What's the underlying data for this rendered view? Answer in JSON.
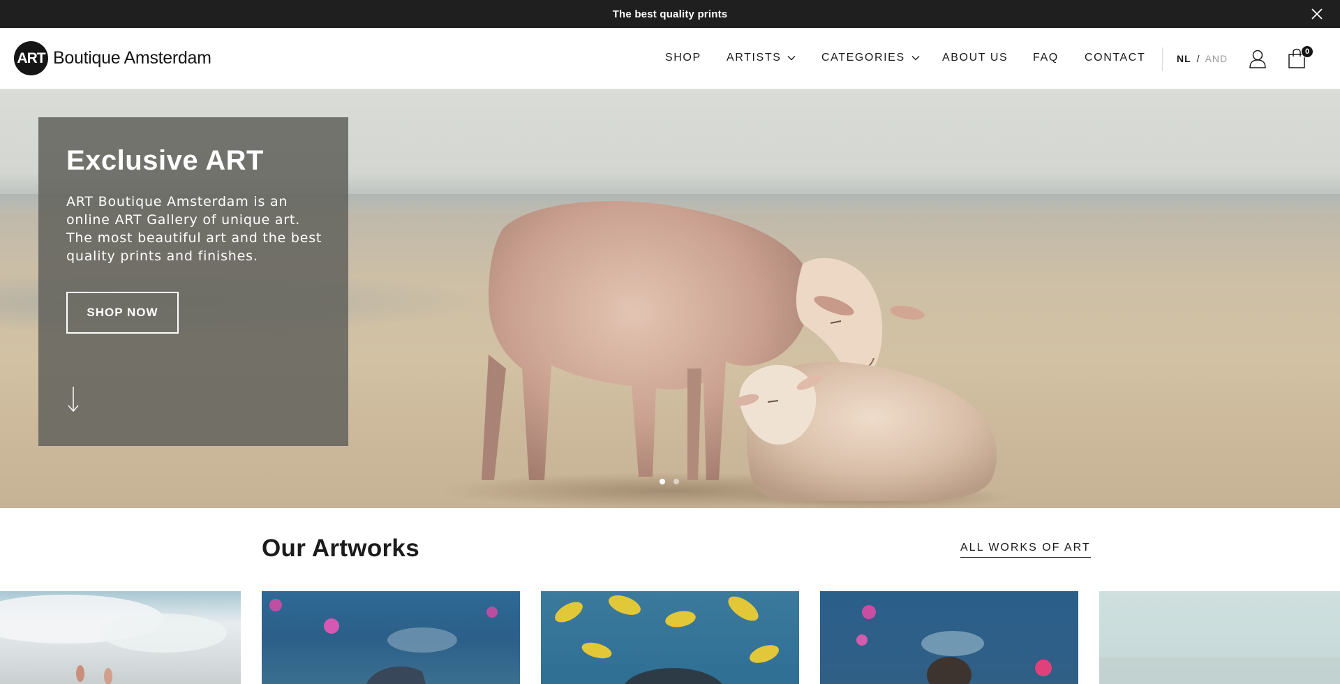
{
  "announcement": {
    "text": "The best quality prints",
    "close_icon": "close-icon"
  },
  "header": {
    "logo_mark": "ART",
    "logo_text": "Boutique Amsterdam",
    "nav": [
      {
        "label": "SHOP",
        "has_dropdown": false
      },
      {
        "label": "ARTISTS",
        "has_dropdown": true
      },
      {
        "label": "CATEGORIES",
        "has_dropdown": true
      },
      {
        "label": "ABOUT US",
        "has_dropdown": false
      },
      {
        "label": "FAQ",
        "has_dropdown": false
      },
      {
        "label": "CONTACT",
        "has_dropdown": false
      }
    ],
    "lang": {
      "active": "NL",
      "separator": "/",
      "inactive": "AND"
    },
    "account_icon": "user-icon",
    "cart_icon": "shopping-bag-icon",
    "cart_count": "0"
  },
  "hero": {
    "title": "Exclusive ART",
    "description": "ART Boutique Amsterdam is an online ART Gallery of unique art. The most beautiful art and the best quality prints and finishes.",
    "button_label": "SHOP NOW",
    "scroll_icon": "arrow-down-icon",
    "slides": 2,
    "active_slide": 1
  },
  "artworks": {
    "title": "Our Artworks",
    "all_link": "ALL WORKS OF ART"
  },
  "colors": {
    "announcement_bg": "#1f1f1f",
    "text": "#1b1b1b",
    "hero_panel": "#64645f"
  }
}
